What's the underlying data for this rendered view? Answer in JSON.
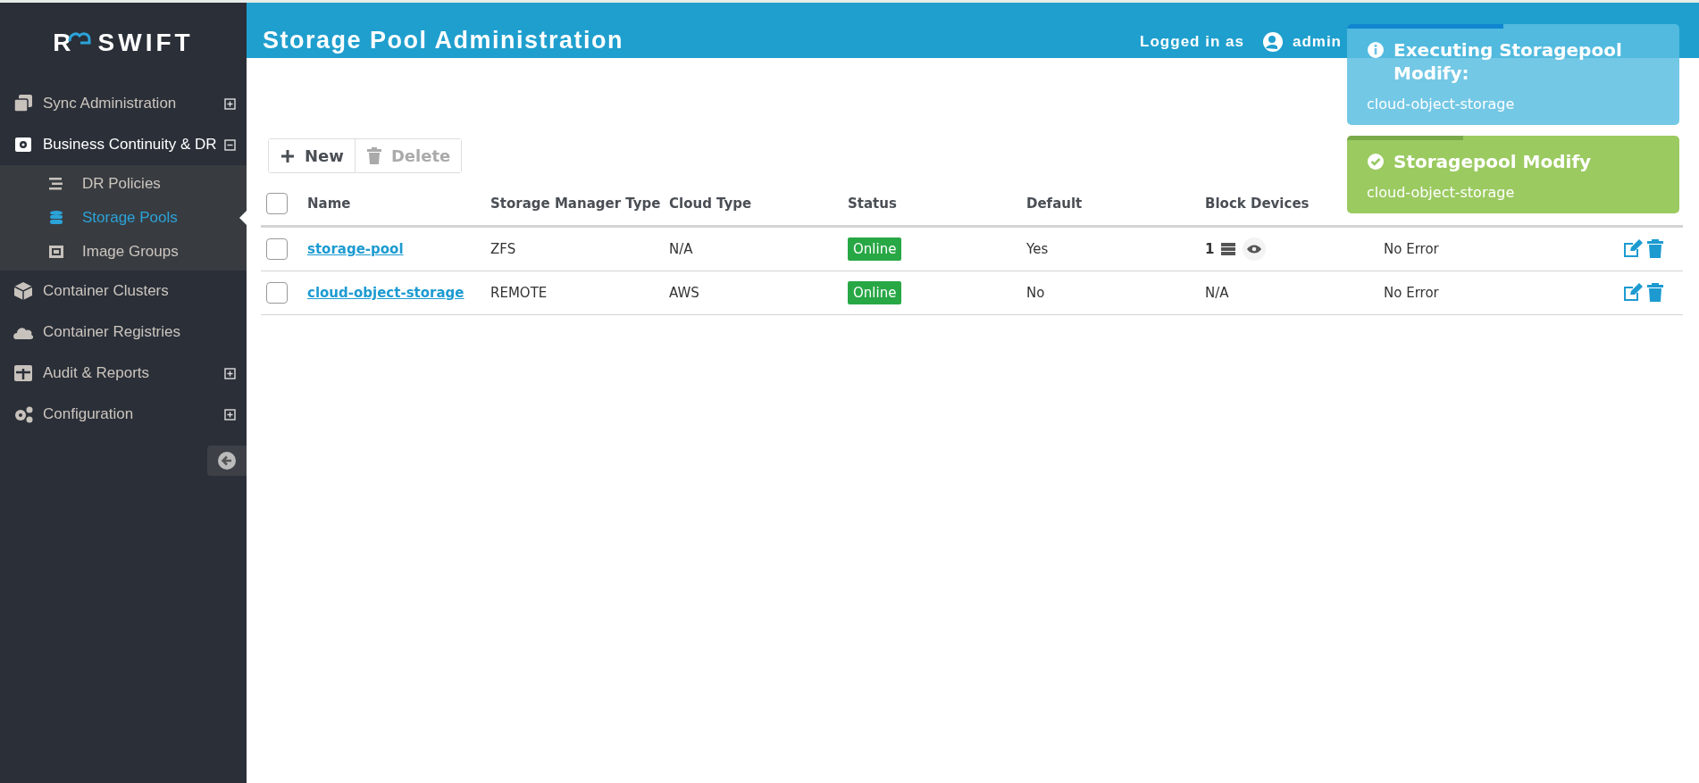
{
  "logo": {
    "mark": "R",
    "name": "SWIFT"
  },
  "sidebar": {
    "items": [
      {
        "label": "Sync Administration",
        "expandable": true,
        "expanded": false,
        "selected": false
      },
      {
        "label": "Business Continuity & DR",
        "expandable": true,
        "expanded": true,
        "selected": false,
        "children": [
          {
            "label": "DR Policies",
            "selected": false
          },
          {
            "label": "Storage Pools",
            "selected": true
          },
          {
            "label": "Image Groups",
            "selected": false
          }
        ]
      },
      {
        "label": "Container Clusters",
        "expandable": false,
        "expanded": false,
        "selected": false
      },
      {
        "label": "Container Registries",
        "expandable": false,
        "expanded": false,
        "selected": false
      },
      {
        "label": "Audit & Reports",
        "expandable": true,
        "expanded": false,
        "selected": false
      },
      {
        "label": "Configuration",
        "expandable": true,
        "expanded": false,
        "selected": false
      }
    ]
  },
  "header": {
    "title": "Storage Pool Administration",
    "logged_in_label": "Logged in as",
    "user": "admin"
  },
  "toolbar": {
    "buttons": [
      {
        "label": "New",
        "disabled": false
      },
      {
        "label": "Delete",
        "disabled": true
      }
    ]
  },
  "table": {
    "all_checked": false,
    "columns": [
      {
        "label": "Name"
      },
      {
        "label": "Storage Manager Type"
      },
      {
        "label": "Cloud Type"
      },
      {
        "label": "Status"
      },
      {
        "label": "Default"
      },
      {
        "label": "Block Devices"
      },
      {},
      {}
    ],
    "rows": [
      {
        "checked": false,
        "name": "storage-pool",
        "manager": "ZFS",
        "cloud": "N/A",
        "status": "Online",
        "default": "Yes",
        "block_devices": "1",
        "device_list": true,
        "last_error": "No Error"
      },
      {
        "checked": false,
        "name": "cloud-object-storage",
        "manager": "REMOTE",
        "cloud": "AWS",
        "status": "Online",
        "default": "No",
        "block_devices": "N/A",
        "device_list": false,
        "last_error": "No Error"
      }
    ]
  },
  "toasts": [
    {
      "kind": "info",
      "title": "Executing Storagepool Modify:",
      "message": "cloud-object-storage",
      "level": 0.47
    },
    {
      "kind": "success",
      "title": "Storagepool Modify",
      "message": "cloud-object-storage",
      "level": 0.35
    }
  ]
}
